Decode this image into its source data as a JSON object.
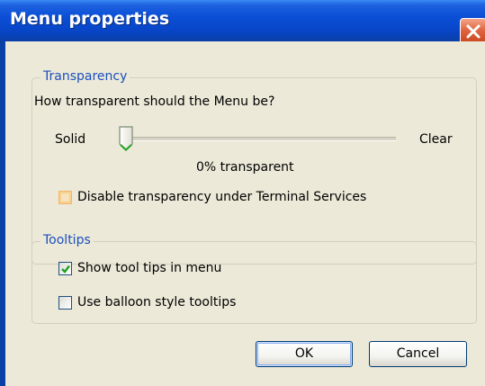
{
  "window": {
    "title": "Menu properties"
  },
  "transparency": {
    "legend": "Transparency",
    "question": "How transparent should the Menu be?",
    "slider_min_label": "Solid",
    "slider_max_label": "Clear",
    "slider_value_percent": 0,
    "value_text": "0% transparent",
    "disable_checkbox_label": "Disable transparency under Terminal Services",
    "disable_checked": false
  },
  "tooltips": {
    "legend": "Tooltips",
    "show_label": "Show tool tips in menu",
    "show_checked": true,
    "balloon_label": "Use balloon style tooltips",
    "balloon_checked": false
  },
  "buttons": {
    "ok": "OK",
    "cancel": "Cancel"
  },
  "colors": {
    "title_bar": "#0a4fd6",
    "dialog_face": "#ece9d8",
    "group_label": "#1c4fbe",
    "check_mark": "#21a121",
    "close_button": "#e06440"
  },
  "icons": {
    "close": "close-x-icon",
    "check": "checkmark-icon",
    "slider_thumb": "slider-thumb-icon"
  }
}
